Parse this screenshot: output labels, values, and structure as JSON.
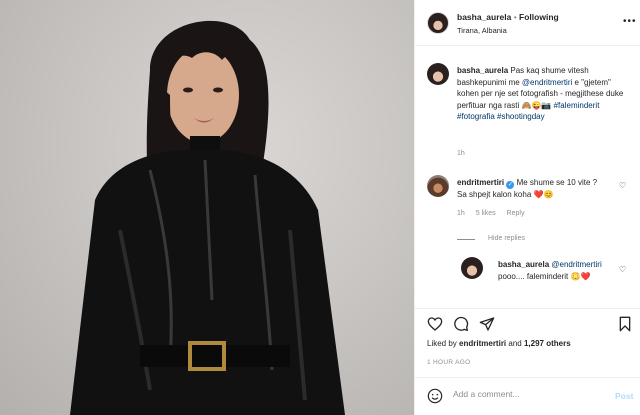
{
  "photo": {
    "alt_subject": "portrait"
  },
  "header": {
    "username": "basha_aurela",
    "separator": " • ",
    "follow_label": "Following",
    "location": "Tirana, Albania",
    "more_label": "•••"
  },
  "caption": {
    "username": "basha_aurela",
    "text": "Pas kaq shume vitesh bashkepunimi me ",
    "mention": "@endritmertiri",
    "text2": " e \"gjetem\" kohen per nje set fotografish - megjithese duke perfituar nga rasti ",
    "emoji_text": "🙈😜📷",
    "hashtags": "#faleminderit #fotografia #shootingday",
    "time": "1h"
  },
  "comment": {
    "username": "endritmertiri",
    "text": "Me shume se 10 vite ? Sa shpejt kalon koha ",
    "emoji_text": "❤️😊",
    "time": "1h",
    "likes": "5 likes",
    "reply_label": "Reply"
  },
  "replies_toggle": "Hide replies",
  "reply": {
    "username": "basha_aurela",
    "mention": "@endritmertiri",
    "text": " pooo.... faleminderit ",
    "emoji_text": "😳❤️"
  },
  "likes": {
    "prefix": "Liked by ",
    "user": "endritmertiri",
    "joiner": " and ",
    "others": "1,297 others"
  },
  "timestamp": "1 HOUR AGO",
  "add_comment": {
    "placeholder": "Add a comment...",
    "post_label": "Post"
  },
  "colors": {
    "link": "#00376b",
    "muted": "#8e8e8e",
    "post_disabled": "#b3dbff",
    "verified": "#3897f0",
    "heart": "#e0245e"
  }
}
